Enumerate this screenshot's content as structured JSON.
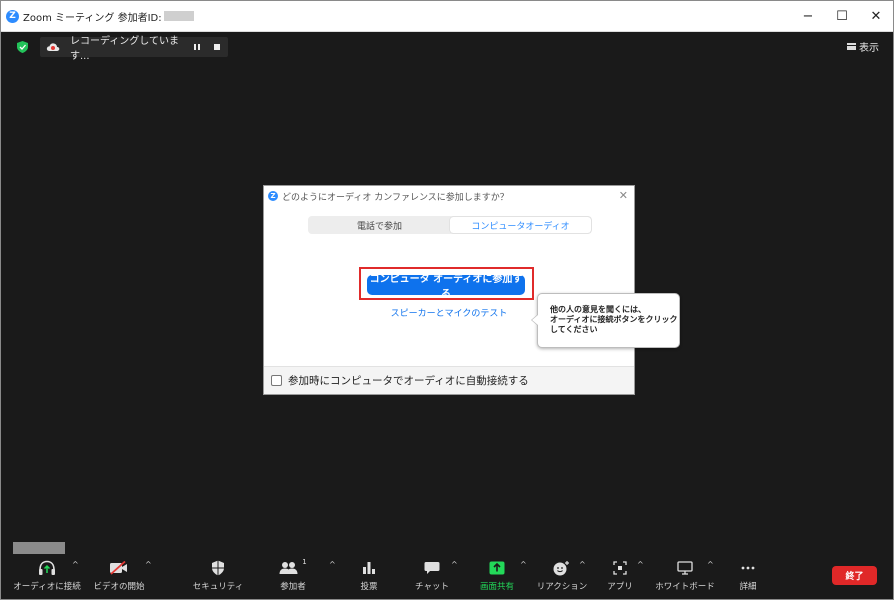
{
  "window": {
    "title": "Zoom ミーティング 参加者ID:",
    "controls": {
      "minimize": "−",
      "maximize": "☐",
      "close": "✕"
    }
  },
  "meeting": {
    "recording_text": "レコーディングしています...",
    "view_label": "表示"
  },
  "dialog": {
    "title": "どのようにオーディオ カンファレンスに参加しますか？",
    "tabs": [
      {
        "label": "電話で参加",
        "active": false
      },
      {
        "label": "コンピュータオーディオ",
        "active": true
      }
    ],
    "join_button": "コンピュータ オーディオに参加する",
    "test_link": "スピーカーとマイクのテスト",
    "auto_connect_label": "参加時にコンピュータでオーディオに自動接続する"
  },
  "tooltip": {
    "lines": [
      "他の人の意見を聞くには、",
      "オーディオに接続ボタンをクリック",
      "してください"
    ]
  },
  "toolbar": {
    "items": [
      {
        "label": "オーディオに接続",
        "icon": "headphone-icon"
      },
      {
        "label": "ビデオの開始",
        "icon": "video-off-icon"
      },
      {
        "label": "セキュリティ",
        "icon": "shield-icon"
      },
      {
        "label": "参加者",
        "icon": "participants-icon",
        "count": "1"
      },
      {
        "label": "投票",
        "icon": "poll-icon"
      },
      {
        "label": "チャット",
        "icon": "chat-icon"
      },
      {
        "label": "画面共有",
        "icon": "share-screen-icon"
      },
      {
        "label": "リアクション",
        "icon": "reaction-icon"
      },
      {
        "label": "アプリ",
        "icon": "apps-icon"
      },
      {
        "label": "ホワイトボード",
        "icon": "whiteboard-icon"
      },
      {
        "label": "詳細",
        "icon": "more-icon"
      }
    ],
    "end_label": "終了"
  },
  "colors": {
    "accent": "#0e72ed",
    "share_green": "#23d959",
    "end_red": "#e02828",
    "highlight_red": "#e02b2b"
  }
}
